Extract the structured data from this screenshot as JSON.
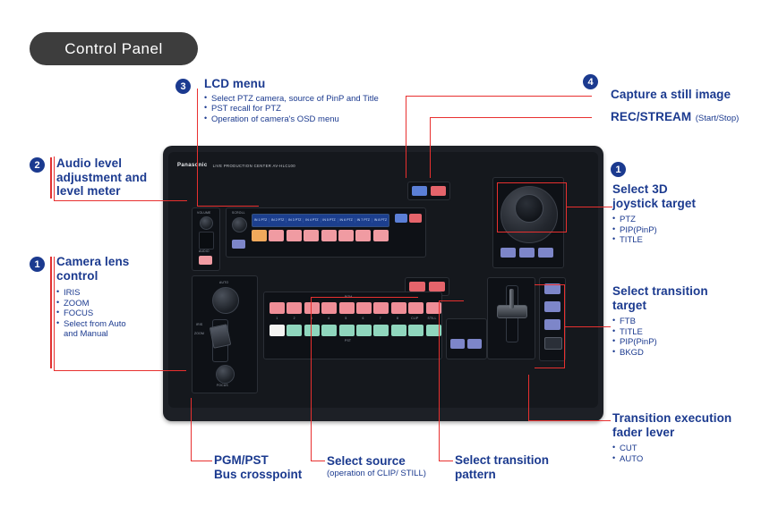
{
  "title": "Control Panel",
  "callouts": {
    "lcd_menu": {
      "badge": "3",
      "head": "LCD menu",
      "items": [
        "Select PTZ camera, source of PinP and Title",
        "PST recall for PTZ",
        "Operation of camera's OSD menu"
      ]
    },
    "capture": {
      "badge": "4",
      "head": "Capture a still image",
      "line2_main": "REC/STREAM",
      "line2_sub": "(Start/Stop)"
    },
    "audio": {
      "badge": "2",
      "head": "Audio level\nadjustment and\nlevel meter"
    },
    "lens": {
      "badge": "1",
      "head": "Camera lens\ncontrol",
      "items": [
        "IRIS",
        "ZOOM",
        "FOCUS",
        "Select from Auto"
      ],
      "items_cont": "and Manual"
    },
    "joystick": {
      "badge": "1",
      "head": "Select 3D\njoystick target",
      "items": [
        "PTZ",
        "PIP(PinP)",
        "TITLE"
      ]
    },
    "transition_target": {
      "head": "Select transition\ntarget",
      "items": [
        "FTB",
        "TITLE",
        "PIP(PinP)",
        "BKGD"
      ]
    },
    "fader": {
      "head": "Transition execution\nfader lever",
      "items": [
        "CUT",
        "AUTO"
      ]
    },
    "bus": {
      "line1": "PGM/PST",
      "line2": "Bus crosspoint"
    },
    "source": {
      "line1": "Select source",
      "line2": "(operation of CLIP/ STILL)"
    },
    "pattern": {
      "line1": "Select transition",
      "line2": "pattern"
    }
  },
  "device": {
    "brand": "Panasonic",
    "model_text": "LIVE PRODUCTION CENTER   AV-HLC100",
    "lcd_segments": [
      "IN 1 PTZ",
      "IN 2 PTZ",
      "IN 3 PTZ",
      "IN 4 PTZ",
      "IN 5 PTZ",
      "IN 6 PTZ",
      "IN 7 PTZ",
      "IN 8 PTZ"
    ],
    "scroll_label": "SCROLL",
    "volume_label": "VOLUME",
    "audio_label": "AUDIO",
    "auto_label": "AUTO",
    "iris_label": "IRIS",
    "zoom_label": "ZOOM",
    "focus_label": "FOCUS",
    "pgm_label": "PGM",
    "pst_label": "PST",
    "xpt_numbers": [
      "1",
      "2",
      "3",
      "4",
      "5",
      "6",
      "7",
      "8"
    ],
    "xpt_extra": [
      "CLIP",
      "STILL"
    ],
    "colors": {
      "accent_red": "#e8302f",
      "label_blue": "#1b3a8f",
      "panel_dark": "#15181d",
      "lcd_blue": "#1c3f8e",
      "key_pink": "#f09ba2",
      "key_green": "#8fd6bd"
    }
  }
}
